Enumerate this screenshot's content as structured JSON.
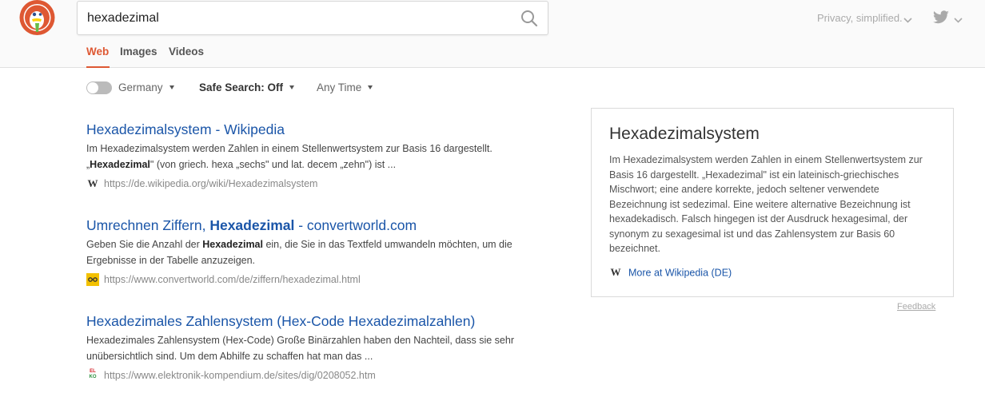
{
  "search": {
    "query": "hexadezimal"
  },
  "header": {
    "privacy_label": "Privacy, simplified."
  },
  "tabs": [
    {
      "label": "Web",
      "active": true
    },
    {
      "label": "Images",
      "active": false
    },
    {
      "label": "Videos",
      "active": false
    }
  ],
  "filters": {
    "region": "Germany",
    "region_toggle_on": false,
    "safe_search": "Safe Search: Off",
    "time": "Any Time"
  },
  "results": [
    {
      "title": "Hexadezimalsystem - Wikipedia",
      "snippet_parts": [
        {
          "text": "Im Hexadezimalsystem werden Zahlen in einem Stellenwertsystem zur Basis 16 dargestellt. „",
          "bold": false
        },
        {
          "text": "Hexadezimal",
          "bold": true
        },
        {
          "text": "\" (von griech. hexa „sechs\" und lat. decem „zehn\") ist ...",
          "bold": false
        }
      ],
      "url": "https://de.wikipedia.org/wiki/Hexadezimalsystem",
      "favicon": "wikipedia-icon"
    },
    {
      "title_parts": [
        {
          "text": "Umrechnen Ziffern, ",
          "bold": false
        },
        {
          "text": "Hexadezimal",
          "bold": true
        },
        {
          "text": " - convertworld.com",
          "bold": false
        }
      ],
      "snippet_parts": [
        {
          "text": "Geben Sie die Anzahl der ",
          "bold": false
        },
        {
          "text": "Hexadezimal",
          "bold": true
        },
        {
          "text": " ein, die Sie in das Textfeld umwandeln möchten, um die Ergebnisse in der Tabelle anzuzeigen.",
          "bold": false
        }
      ],
      "url": "https://www.convertworld.com/de/ziffern/hexadezimal.html",
      "favicon": "convertworld-icon"
    },
    {
      "title": "Hexadezimales Zahlensystem (Hex-Code Hexadezimalzahlen)",
      "snippet": "Hexadezimales Zahlensystem (Hex-Code) Große Binärzahlen haben den Nachteil, dass sie sehr unübersichtlich sind. Um dem Abhilfe zu schaffen hat man das ...",
      "url": "https://www.elektronik-kompendium.de/sites/dig/0208052.htm",
      "favicon": "elko-icon",
      "favicon_text": [
        "EL",
        "KO"
      ]
    }
  ],
  "panel": {
    "title": "Hexadezimalsystem",
    "text": "Im Hexadezimalsystem werden Zahlen in einem Stellenwertsystem zur Basis 16 dargestellt. „Hexadezimal\" ist ein lateinisch-griechisches Mischwort; eine andere korrekte, jedoch seltener verwendete Bezeichnung ist sedezimal. Eine weitere alternative Bezeichnung ist hexadekadisch. Falsch hingegen ist der Ausdruck hexagesimal, der synonym zu sexagesimal ist und das Zahlensystem zur Basis 60 bezeichnet.",
    "more_label": "More at Wikipedia (DE)",
    "feedback_label": "Feedback"
  },
  "icons": {
    "wikipedia_glyph": "W"
  },
  "colors": {
    "accent": "#de5833",
    "link": "#1a55a8",
    "url": "#888888"
  }
}
